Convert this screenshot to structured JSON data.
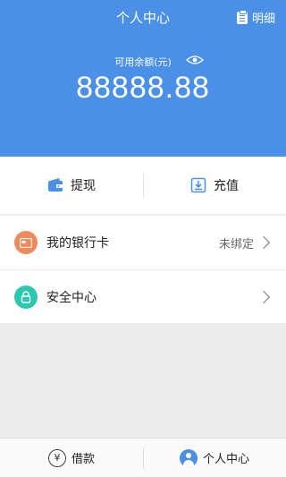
{
  "header": {
    "title": "个人中心",
    "detail_label": "明细",
    "balance_label": "可用余额(元)",
    "balance": "88888.88"
  },
  "actions": {
    "withdraw_label": "提现",
    "recharge_label": "充值"
  },
  "list": {
    "bank_card_label": "我的银行卡",
    "bank_card_status": "未绑定",
    "security_label": "安全中心"
  },
  "tabbar": {
    "loan_label": "借款",
    "loan_icon_glyph": "¥",
    "profile_label": "个人中心"
  },
  "colors": {
    "primary": "#4a90e8",
    "bank_icon": "#f08a5d",
    "security_icon": "#2bc7b0"
  }
}
